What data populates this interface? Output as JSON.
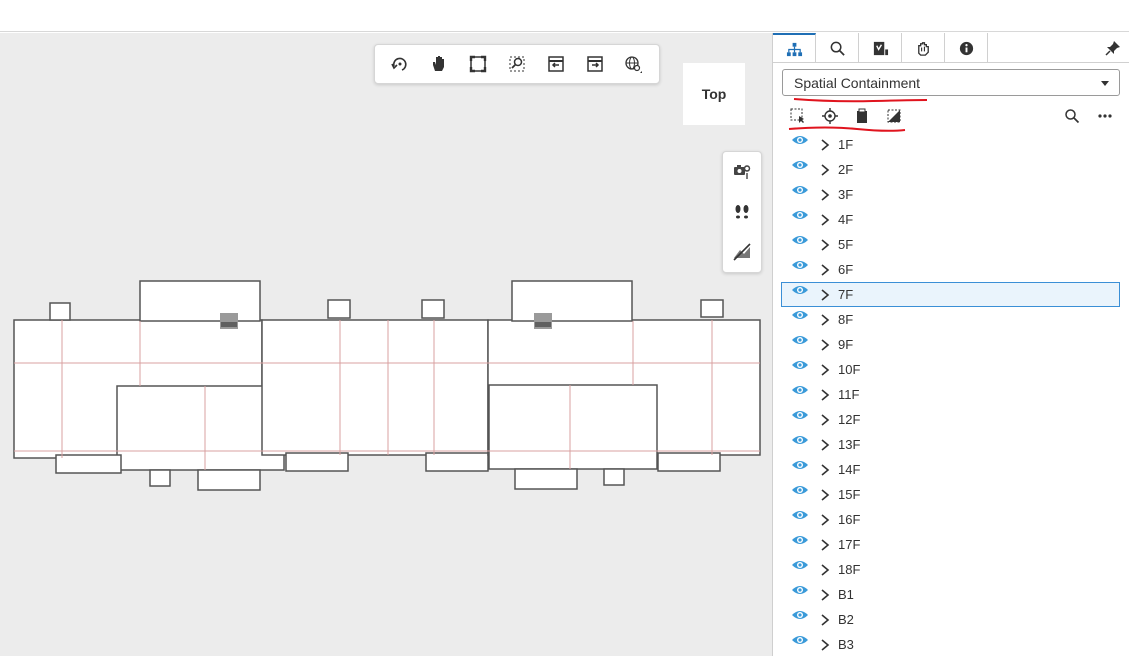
{
  "viewer": {
    "viewcube_label": "Top",
    "toolbar": [
      {
        "name": "orbit-icon"
      },
      {
        "name": "pan-icon"
      },
      {
        "name": "fit-view-icon"
      },
      {
        "name": "zoom-window-icon"
      },
      {
        "name": "previous-view-icon"
      },
      {
        "name": "next-view-icon"
      },
      {
        "name": "globe-settings-icon"
      }
    ],
    "side_tools": [
      {
        "name": "camera-location-icon"
      },
      {
        "name": "walk-icon"
      },
      {
        "name": "hide-icon"
      }
    ]
  },
  "panel": {
    "tabs": [
      {
        "name": "tree-icon",
        "active": true
      },
      {
        "name": "search-icon",
        "active": false
      },
      {
        "name": "properties-icon",
        "active": false
      },
      {
        "name": "layers-icon",
        "active": false
      },
      {
        "name": "info-icon",
        "active": false
      }
    ],
    "dropdown_value": "Spatial Containment",
    "tree_items": [
      {
        "label": "1F"
      },
      {
        "label": "2F"
      },
      {
        "label": "3F"
      },
      {
        "label": "4F"
      },
      {
        "label": "5F"
      },
      {
        "label": "6F"
      },
      {
        "label": "7F",
        "selected": true
      },
      {
        "label": "8F"
      },
      {
        "label": "9F"
      },
      {
        "label": "10F"
      },
      {
        "label": "11F"
      },
      {
        "label": "12F"
      },
      {
        "label": "13F"
      },
      {
        "label": "14F"
      },
      {
        "label": "15F"
      },
      {
        "label": "16F"
      },
      {
        "label": "17F"
      },
      {
        "label": "18F"
      },
      {
        "label": "B1"
      },
      {
        "label": "B2"
      },
      {
        "label": "B3"
      }
    ]
  },
  "colors": {
    "accent": "#1f6fb5",
    "eye": "#3a9ad9",
    "annotation_red": "#e0141e",
    "selection_border": "#3b8fd6"
  }
}
